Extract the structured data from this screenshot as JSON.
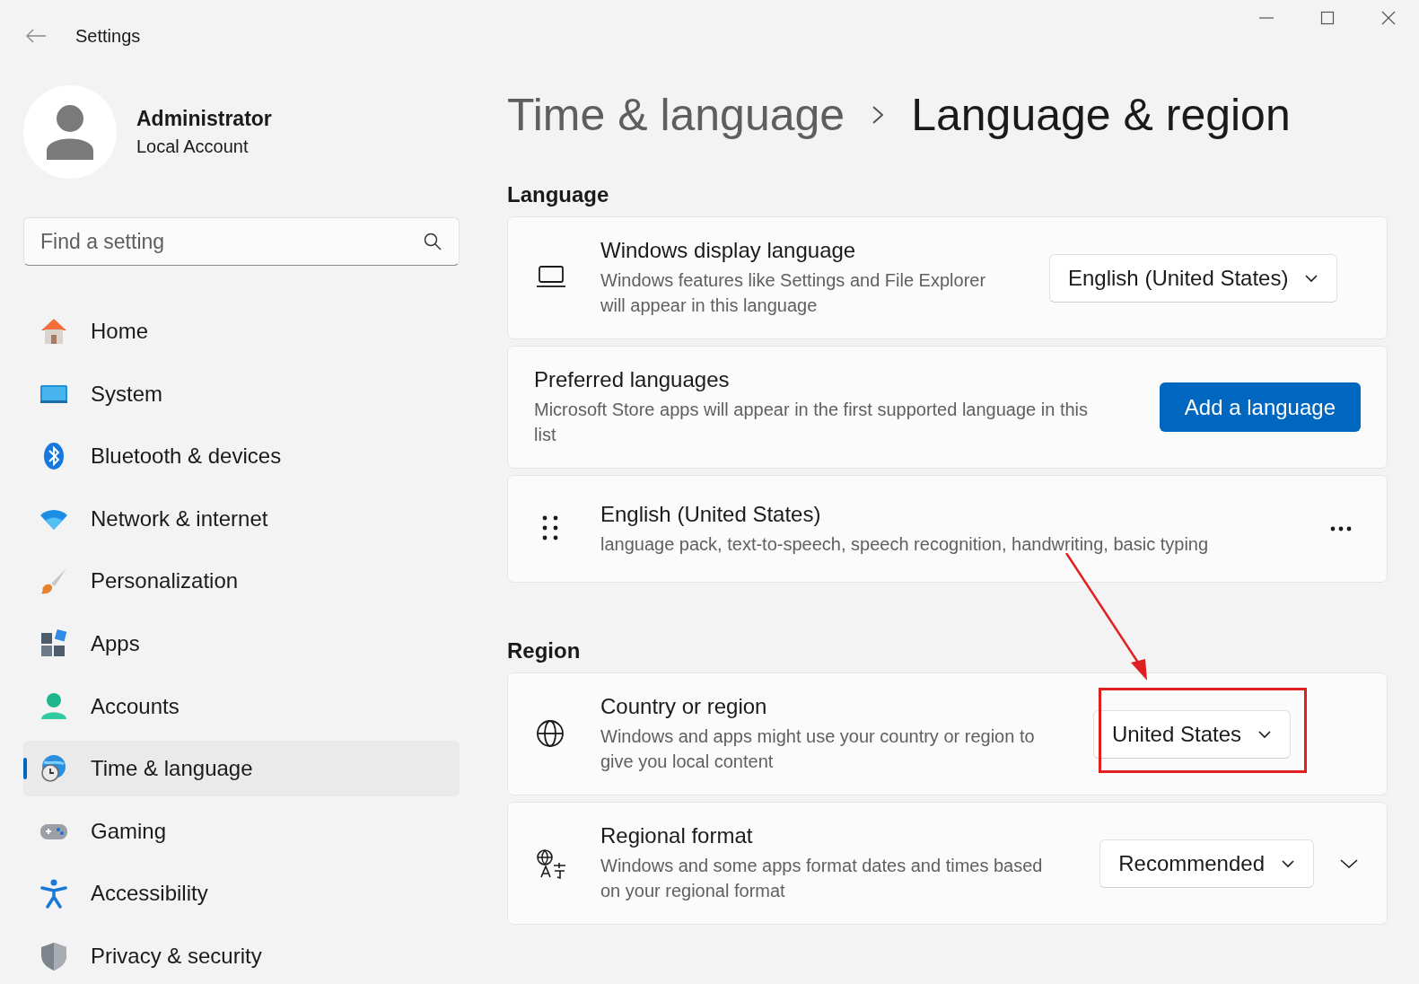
{
  "window": {
    "title": "Settings"
  },
  "user": {
    "name": "Administrator",
    "account": "Local Account"
  },
  "search": {
    "placeholder": "Find a setting"
  },
  "nav": [
    {
      "label": "Home",
      "selected": false
    },
    {
      "label": "System",
      "selected": false
    },
    {
      "label": "Bluetooth & devices",
      "selected": false
    },
    {
      "label": "Network & internet",
      "selected": false
    },
    {
      "label": "Personalization",
      "selected": false
    },
    {
      "label": "Apps",
      "selected": false
    },
    {
      "label": "Accounts",
      "selected": false
    },
    {
      "label": "Time & language",
      "selected": true
    },
    {
      "label": "Gaming",
      "selected": false
    },
    {
      "label": "Accessibility",
      "selected": false
    },
    {
      "label": "Privacy & security",
      "selected": false
    }
  ],
  "breadcrumb": {
    "parent": "Time & language",
    "current": "Language & region"
  },
  "sections": [
    {
      "title": "Language",
      "cards": [
        {
          "kind": "dropdown",
          "title": "Windows display language",
          "description": "Windows features like Settings and File Explorer will appear in this language",
          "value": "English (United States)"
        },
        {
          "kind": "button",
          "title": "Preferred languages",
          "description": "Microsoft Store apps will appear in the first supported language in this list",
          "button": "Add a language"
        },
        {
          "kind": "language",
          "title": "English (United States)",
          "description": "language pack, text-to-speech, speech recognition, handwriting, basic typing"
        }
      ]
    },
    {
      "title": "Region",
      "cards": [
        {
          "kind": "dropdown",
          "title": "Country or region",
          "description": "Windows and apps might use your country or region to give you local content",
          "value": "United States",
          "highlighted": true
        },
        {
          "kind": "dropdown",
          "title": "Regional format",
          "description": "Windows and some apps format dates and times based on your regional format",
          "value": "Recommended",
          "expanded": false
        }
      ]
    }
  ]
}
